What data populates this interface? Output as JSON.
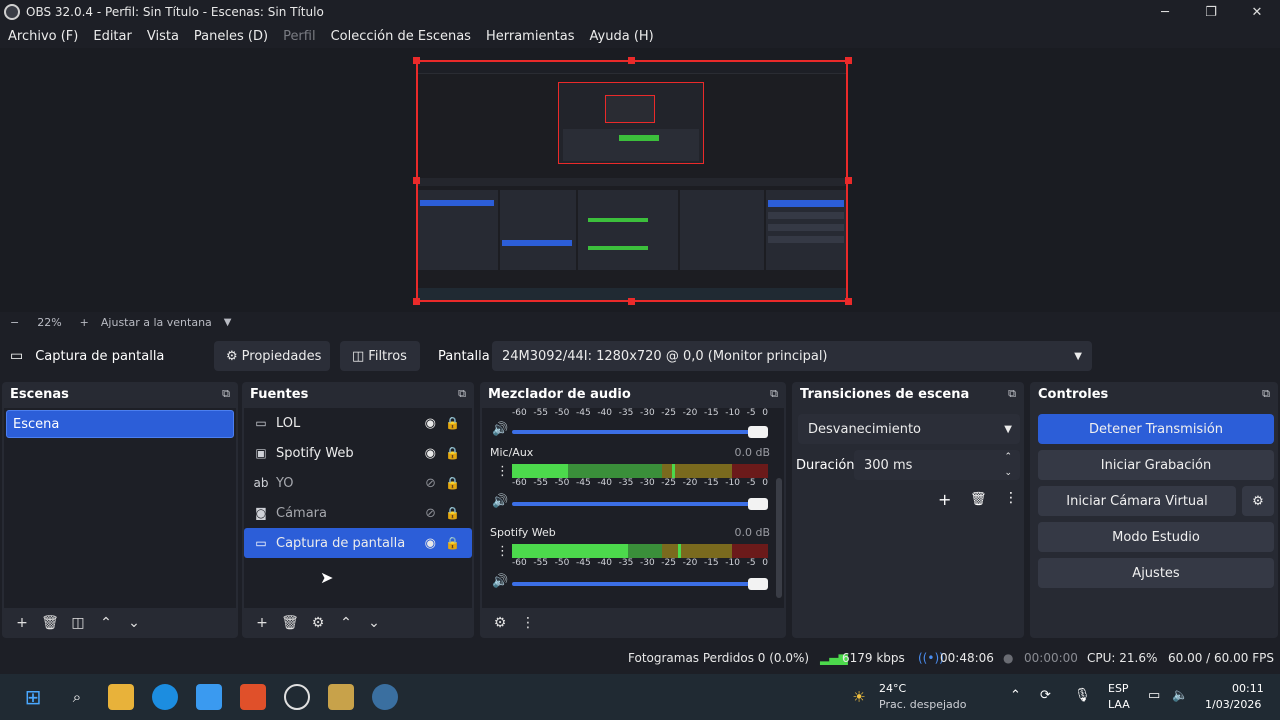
{
  "window": {
    "title": "OBS 32.0.4 - Perfil: Sin Título - Escenas: Sin Título",
    "minimize": "─",
    "maximize": "❐",
    "close": "✕"
  },
  "menu": [
    "Archivo (F)",
    "Editar",
    "Vista",
    "Paneles (D)",
    "Perfil",
    "Colección de Escenas",
    "Herramientas",
    "Ayuda (H)"
  ],
  "zoom": {
    "minus": "−",
    "level": "22%",
    "plus": "+",
    "fit": "Ajustar a la ventana",
    "arrow": "▼"
  },
  "source_bar": {
    "current": "Captura de pantalla",
    "properties": "Propiedades",
    "filters": "Filtros",
    "display_label": "Pantalla",
    "display_value": "24M3092/44I: 1280x720 @ 0,0 (Monitor principal)"
  },
  "scenes": {
    "title": "Escenas",
    "items": [
      "Escena"
    ]
  },
  "sources": {
    "title": "Fuentes",
    "items": [
      {
        "label": "LOL",
        "icon": "monitor-icon"
      },
      {
        "label": "Spotify Web",
        "icon": "browser-icon"
      },
      {
        "label": "YO",
        "icon": "text-icon"
      },
      {
        "label": "Cámara",
        "icon": "camera-icon"
      },
      {
        "label": "Captura de pantalla",
        "icon": "display-icon"
      }
    ]
  },
  "mixer": {
    "title": "Mezclador de audio",
    "ticks": [
      "-60",
      "-55",
      "-50",
      "-45",
      "-40",
      "-35",
      "-30",
      "-25",
      "-20",
      "-15",
      "-10",
      "-5",
      "0"
    ],
    "channels": [
      {
        "name": "Mic/Aux",
        "db": "0.0 dB"
      },
      {
        "name": "Spotify Web",
        "db": "0.0 dB"
      }
    ]
  },
  "transitions": {
    "title": "Transiciones de escena",
    "type": "Desvanecimiento",
    "duration_label": "Duración",
    "duration_value": "300 ms"
  },
  "controls": {
    "title": "Controles",
    "stop_stream": "Detener Transmisión",
    "start_recording": "Iniciar Grabación",
    "start_virtual_cam": "Iniciar Cámara Virtual",
    "studio_mode": "Modo Estudio",
    "settings": "Ajustes"
  },
  "status": {
    "dropped_frames": "Fotogramas Perdidos 0 (0.0%)",
    "bitrate": "6179 kbps",
    "stream_time": "00:48:06",
    "record_time": "00:00:00",
    "cpu": "CPU: 21.6%",
    "fps": "60.00 / 60.00 FPS"
  },
  "taskbar": {
    "temperature": "24°C",
    "weather": "Prac. despejado",
    "lang": "ESP",
    "layout": "LAA",
    "time": "00:11",
    "date": "1/03/2026"
  }
}
